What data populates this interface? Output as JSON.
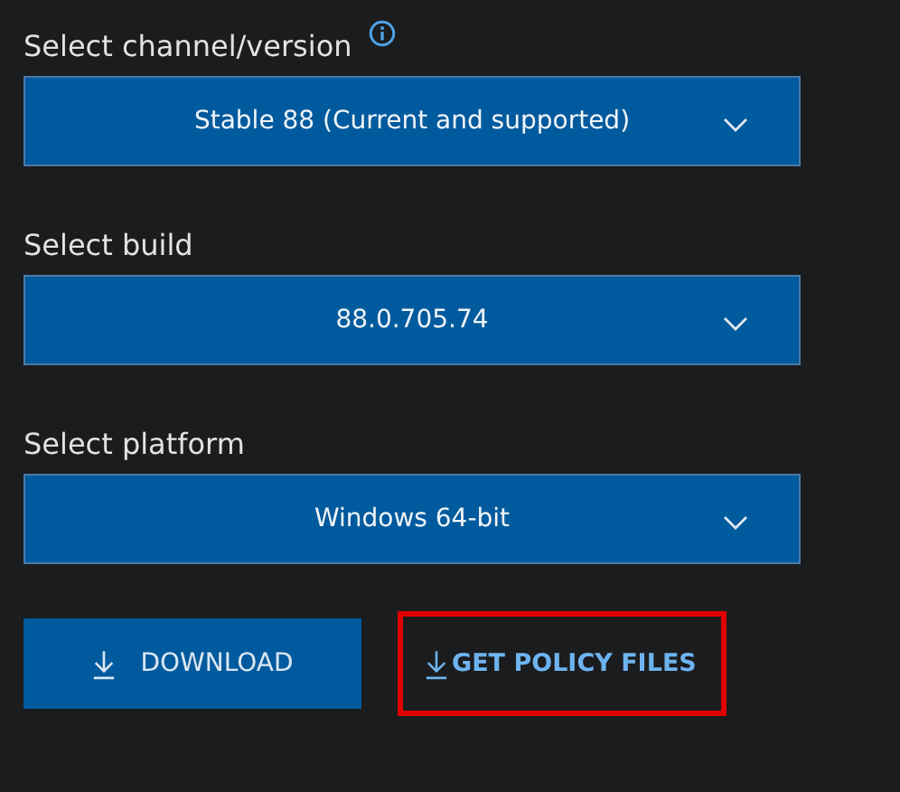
{
  "fields": [
    {
      "label": "Select channel/version",
      "info": true,
      "value": "Stable 88 (Current and supported)"
    },
    {
      "label": "Select build",
      "info": false,
      "value": "88.0.705.74"
    },
    {
      "label": "Select platform",
      "info": false,
      "value": "Windows 64-bit"
    }
  ],
  "actions": [
    {
      "kind": "button",
      "label": "DOWNLOAD",
      "highlighted": false
    },
    {
      "kind": "link",
      "label": "GET POLICY FILES",
      "highlighted": true
    }
  ]
}
